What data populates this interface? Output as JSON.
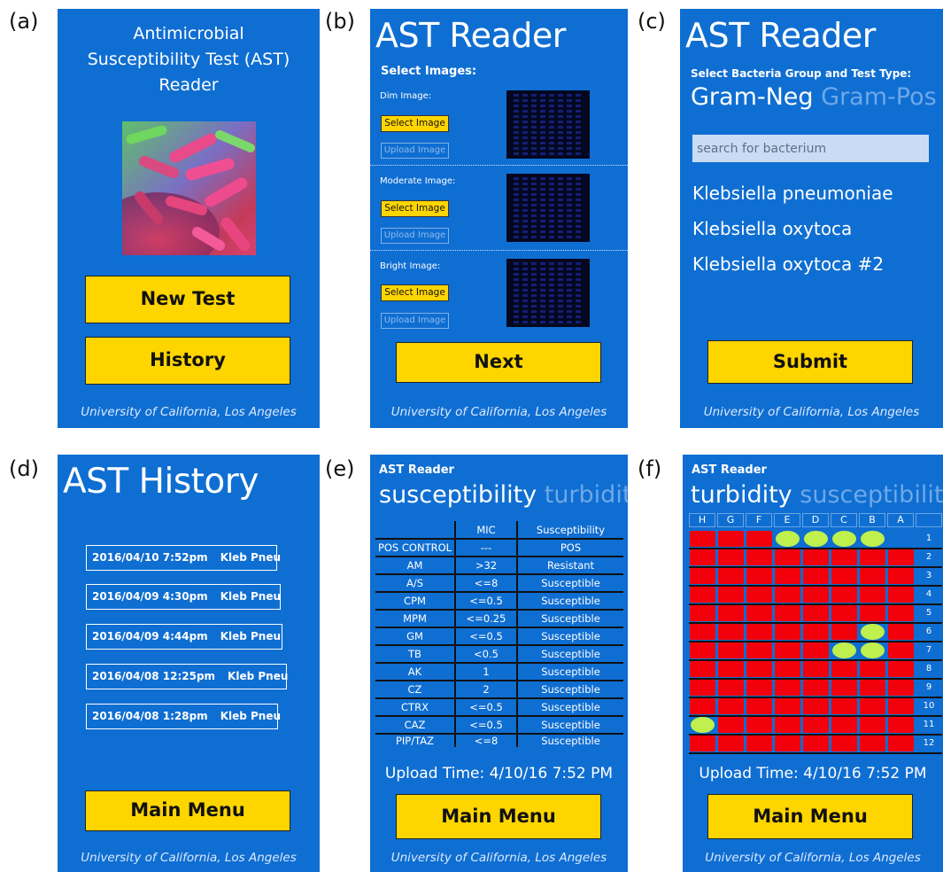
{
  "panel_letters": [
    "(a)",
    "(b)",
    "(c)",
    "(d)",
    "(e)",
    "(f)"
  ],
  "footer": "University of California, Los Angeles",
  "panel_a": {
    "title_lines": [
      "Antimicrobial",
      "Susceptibility Test (AST)",
      "Reader"
    ],
    "new_test": "New Test",
    "history": "History"
  },
  "panel_b": {
    "title": "AST Reader",
    "select_images": "Select Images:",
    "images": [
      {
        "label": "Dim Image:",
        "select": "Select Image",
        "upload": "Upload Image"
      },
      {
        "label": "Moderate Image:",
        "select": "Select Image",
        "upload": "Upload Image"
      },
      {
        "label": "Bright Image:",
        "select": "Select Image",
        "upload": "Upload Image"
      }
    ],
    "next": "Next"
  },
  "panel_c": {
    "title": "AST Reader",
    "group_label": "Select Bacteria Group and Test Type:",
    "pivot_active": "Gram-Neg",
    "pivot_inactive": "Gram-Pos",
    "search_placeholder": "search for bacterium",
    "bacteria": [
      "Klebsiella pneumoniae",
      "Klebsiella oxytoca",
      "Klebsiella oxytoca #2"
    ],
    "submit": "Submit"
  },
  "panel_d": {
    "title": "AST History",
    "entries": [
      {
        "time": "2016/04/10 7:52pm",
        "organism": "Kleb Pneu"
      },
      {
        "time": "2016/04/09 4:30pm",
        "organism": "Kleb Pneu"
      },
      {
        "time": "2016/04/09 4:44pm",
        "organism": "Kleb Pneu"
      },
      {
        "time": "2016/04/08 12:25pm",
        "organism": "Kleb Pneu"
      },
      {
        "time": "2016/04/08 1:28pm",
        "organism": "Kleb Pneu"
      }
    ],
    "main_menu": "Main Menu"
  },
  "panel_e": {
    "app": "AST Reader",
    "pivot_active": "susceptibility",
    "pivot_inactive": "turbidity",
    "headers": [
      "",
      "MIC",
      "Susceptibility"
    ],
    "rows": [
      [
        "POS CONTROL",
        "---",
        "POS"
      ],
      [
        "AM",
        ">32",
        "Resistant"
      ],
      [
        "A/S",
        "<=8",
        "Susceptible"
      ],
      [
        "CPM",
        "<=0.5",
        "Susceptible"
      ],
      [
        "MPM",
        "<=0.25",
        "Susceptible"
      ],
      [
        "GM",
        "<=0.5",
        "Susceptible"
      ],
      [
        "TB",
        "<0.5",
        "Susceptible"
      ],
      [
        "AK",
        "1",
        "Susceptible"
      ],
      [
        "CZ",
        "2",
        "Susceptible"
      ],
      [
        "CTRX",
        "<=0.5",
        "Susceptible"
      ],
      [
        "CAZ",
        "<=0.5",
        "Susceptible"
      ],
      [
        "PIP/TAZ",
        "<=8",
        "Susceptible"
      ]
    ],
    "upload_time": "Upload Time: 4/10/16 7:52 PM",
    "main_menu": "Main Menu"
  },
  "panel_f": {
    "app": "AST Reader",
    "pivot_active": "turbidity",
    "pivot_inactive": "susceptibility",
    "columns": [
      "H",
      "G",
      "F",
      "E",
      "D",
      "C",
      "B",
      "A"
    ],
    "rows": [
      "1",
      "2",
      "3",
      "4",
      "5",
      "6",
      "7",
      "8",
      "9",
      "10",
      "11",
      "12"
    ],
    "wells": [
      "RRRGGGG.",
      "RRRRRRRR",
      "RRRRRRRR",
      "RRRRRRRR",
      "RRRRRRRR",
      "RRRRRRGR",
      "RRRRRGGR",
      "RRRRRRRR",
      "RRRRRRRR",
      "RRRRRRRR",
      "GRRRRRRR",
      "RRRRRRRR"
    ],
    "colors": {
      "turbid": "#f2000b",
      "clear": "#bff04d",
      "screen": "#0f6ed2",
      "button": "#ffd500"
    },
    "upload_time": "Upload Time: 4/10/16 7:52 PM",
    "main_menu": "Main Menu"
  }
}
